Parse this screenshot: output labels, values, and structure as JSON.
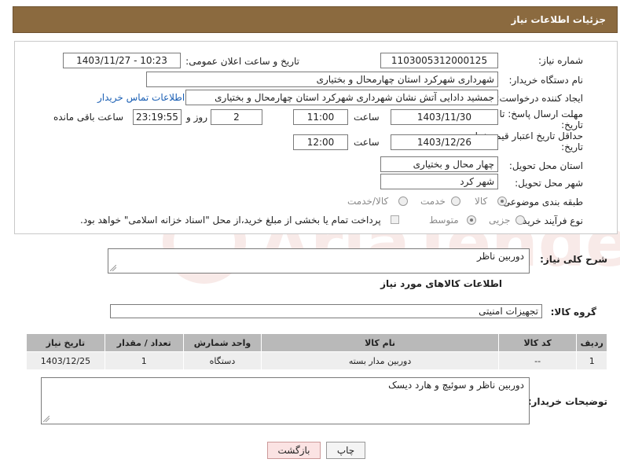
{
  "header": {
    "title": "جزئیات اطلاعات نیاز"
  },
  "form": {
    "need_number_label": "شماره نیاز:",
    "need_number": "1103005312000125",
    "announce_label": "تاریخ و ساعت اعلان عمومی:",
    "announce_value": "1403/11/27 - 10:23",
    "buyer_org_label": "نام دستگاه خریدار:",
    "buyer_org": "شهرداری شهرکرد استان چهارمحال و بختیاری",
    "requester_label": "ایجاد کننده درخواست:",
    "requester": "جمشید دادایی آتش نشان شهرداری شهرکرد استان چهارمحال و بختیاری",
    "contact_link": "اطلاعات تماس خریدار",
    "deadline_label_1": "مهلت ارسال پاسخ: تا",
    "deadline_label_2": "تاریخ:",
    "deadline_date": "1403/11/30",
    "time_label": "ساعت",
    "deadline_time": "11:00",
    "days_value": "2",
    "days_label": "روز و",
    "remaining_time": "23:19:55",
    "remaining_label": "ساعت باقی مانده",
    "price_label_1": "حداقل تاریخ اعتبار قیمت: تا",
    "price_label_2": "تاریخ:",
    "price_date": "1403/12/26",
    "price_time_label": "ساعت",
    "price_time": "12:00",
    "province_label": "استان محل تحویل:",
    "province": "چهار محال و بختیاری",
    "city_label": "شهر محل تحویل:",
    "city": "شهر کرد",
    "category_label": "طبقه بندی موضوعی:",
    "category_options": [
      "کالا",
      "خدمت",
      "کالا/خدمت"
    ],
    "process_label": "نوع فرآیند خرید :",
    "process_options": [
      "جزیی",
      "متوسط"
    ],
    "payment_note": "پرداخت تمام یا بخشی از مبلغ خرید،از محل \"اسناد خزانه اسلامی\" خواهد بود."
  },
  "summary": {
    "label": "شرح کلی نیاز:",
    "value": "دوربین ناظر"
  },
  "goods_info_title": "اطلاعات کالاهای مورد نیاز",
  "goods_group": {
    "label": "گروه کالا:",
    "value": "تجهیزات امنیتی"
  },
  "table": {
    "headers": [
      "ردیف",
      "کد کالا",
      "نام کالا",
      "واحد شمارش",
      "تعداد / مقدار",
      "تاریخ نیاز"
    ],
    "rows": [
      [
        "1",
        "--",
        "دوربین مدار بسته",
        "دستگاه",
        "1",
        "1403/12/25"
      ]
    ]
  },
  "buyer_notes": {
    "label": "توضیحات خریدار:",
    "value": "دوربین ناظر و سوئیچ و هارد دیسک"
  },
  "buttons": {
    "print": "چاپ",
    "back": "بازگشت"
  },
  "watermark": {
    "text": "AriaTender.net"
  },
  "colors": {
    "header_bg": "#8b6a3f",
    "link": "#1a5fb4",
    "table_header": "#b9b9b9",
    "back_button_bg": "#fbe3e3"
  }
}
